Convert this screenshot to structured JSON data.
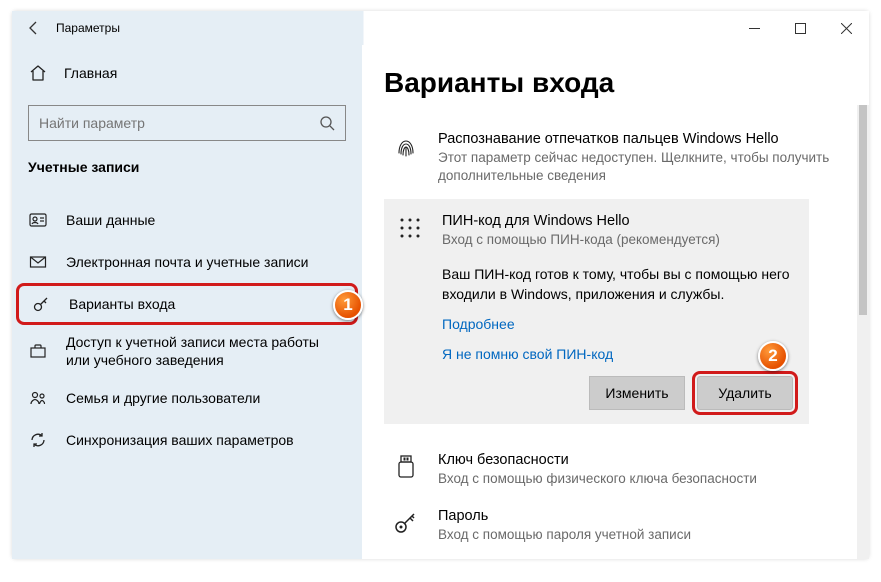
{
  "window": {
    "title": "Параметры"
  },
  "sidebar": {
    "home": "Главная",
    "search_placeholder": "Найти параметр",
    "section": "Учетные записи",
    "items": [
      {
        "label": "Ваши данные"
      },
      {
        "label": "Электронная почта и учетные записи"
      },
      {
        "label": "Варианты входа"
      },
      {
        "label": "Доступ к учетной записи места работы или учебного заведения"
      },
      {
        "label": "Семья и другие пользователи"
      },
      {
        "label": "Синхронизация ваших параметров"
      }
    ]
  },
  "main": {
    "title": "Варианты входа",
    "fingerprint": {
      "title": "Распознавание отпечатков пальцев Windows Hello",
      "sub": "Этот параметр сейчас недоступен. Щелкните, чтобы получить дополнительные сведения"
    },
    "pin": {
      "title": "ПИН-код для Windows Hello",
      "sub": "Вход с помощью ПИН-кода (рекомендуется)",
      "desc": "Ваш ПИН-код готов к тому, чтобы вы с помощью него входили в Windows, приложения и службы.",
      "link_more": "Подробнее",
      "link_forgot": "Я не помню свой ПИН-код",
      "btn_change": "Изменить",
      "btn_remove": "Удалить"
    },
    "seckey": {
      "title": "Ключ безопасности",
      "sub": "Вход с помощью физического ключа безопасности"
    },
    "password": {
      "title": "Пароль",
      "sub": "Вход с помощью пароля учетной записи"
    }
  },
  "annotations": {
    "one": "1",
    "two": "2"
  }
}
